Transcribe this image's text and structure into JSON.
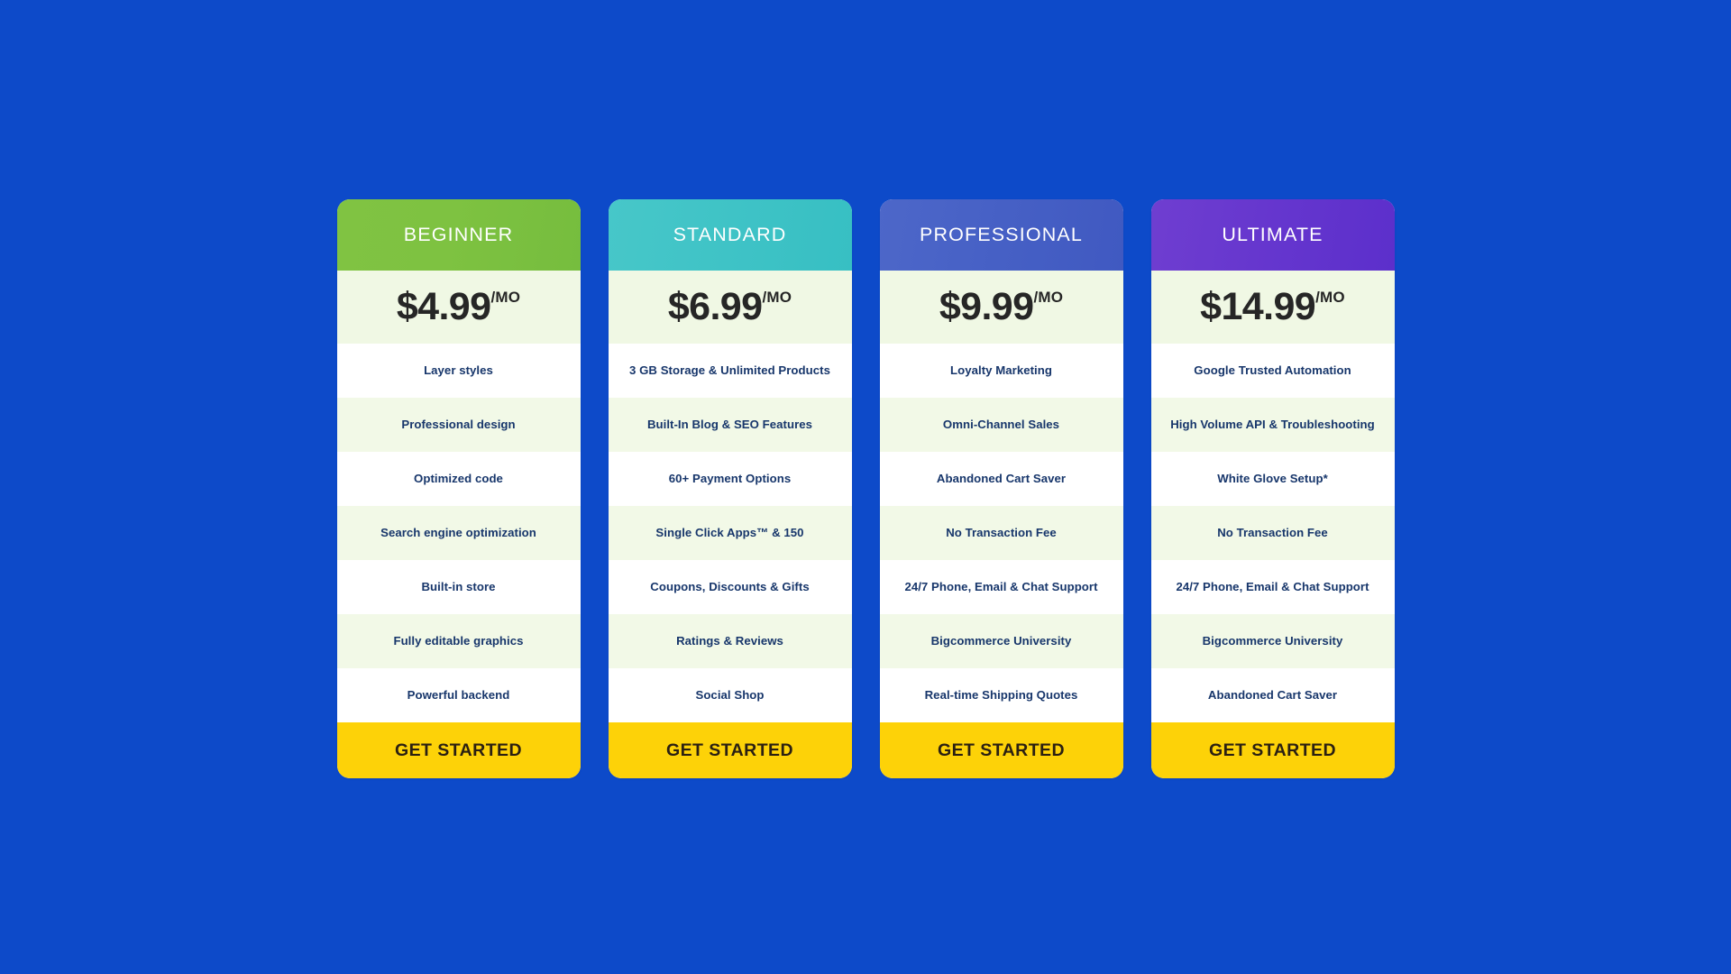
{
  "page": {
    "background_color": "#0d4ac9",
    "cta_color": "#fdd208",
    "price_band_color": "#f0f8e4",
    "feature_text_color": "#17366b"
  },
  "plans": [
    {
      "name": "BEGINNER",
      "header_color": "#7ec241",
      "price_amount": "$4.99",
      "price_period": "/MO",
      "cta_label": "GET STARTED",
      "features": [
        "Layer styles",
        "Professional design",
        "Optimized code",
        "Search engine optimization",
        "Built-in store",
        "Fully editable graphics",
        "Powerful backend"
      ]
    },
    {
      "name": "STANDARD",
      "header_color": "#3fc3c6",
      "price_amount": "$6.99",
      "price_period": "/MO",
      "cta_label": "GET STARTED",
      "features": [
        "3 GB Storage & Unlimited Products",
        "Built-In Blog & SEO Features",
        "60+ Payment Options",
        "Single Click Apps™ & 150",
        "Coupons, Discounts & Gifts",
        "Ratings & Reviews",
        "Social Shop"
      ]
    },
    {
      "name": "PROFESSIONAL",
      "header_color": "#4660c5",
      "price_amount": "$9.99",
      "price_period": "/MO",
      "cta_label": "GET STARTED",
      "features": [
        "Loyalty Marketing",
        "Omni-Channel Sales",
        "Abandoned Cart Saver",
        "No Transaction Fee",
        "24/7 Phone, Email & Chat Support",
        "Bigcommerce University",
        "Real-time Shipping Quotes"
      ]
    },
    {
      "name": "ULTIMATE",
      "header_color": "#6536ce",
      "price_amount": "$14.99",
      "price_period": "/MO",
      "cta_label": "GET STARTED",
      "features": [
        "Google Trusted Automation",
        "High Volume API & Troubleshooting",
        "White Glove Setup*",
        "No Transaction Fee",
        "24/7 Phone, Email & Chat Support",
        "Bigcommerce University",
        "Abandoned Cart Saver"
      ]
    }
  ]
}
